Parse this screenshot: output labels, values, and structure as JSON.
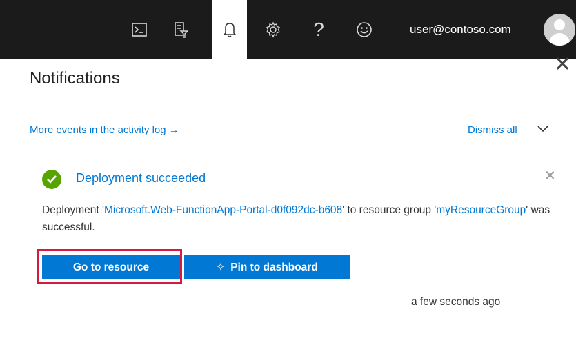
{
  "topbar": {
    "icons": [
      {
        "name": "cloud-shell-icon",
        "glyph": "⌨"
      },
      {
        "name": "directory-filter-icon",
        "glyph": "⧉"
      },
      {
        "name": "notifications-bell-icon",
        "glyph": "🔔"
      },
      {
        "name": "settings-gear-icon",
        "glyph": "⚙"
      },
      {
        "name": "help-icon",
        "glyph": "?"
      },
      {
        "name": "feedback-smiley-icon",
        "glyph": "☺"
      }
    ],
    "user_email": "user@contoso.com"
  },
  "notifications": {
    "title": "Notifications",
    "more_events_link": "More events in the activity log →",
    "dismiss_all": "Dismiss all",
    "item": {
      "title": "Deployment succeeded",
      "message_part1": "Deployment '",
      "resource_name": "Microsoft.Web-FunctionApp-Portal-d0f092dc-b608",
      "message_part2": "' to resource group '",
      "resource_group": "myResourceGroup",
      "message_part3": "' was successful.",
      "go_to_resource": "Go to resource",
      "pin_to_dashboard": "Pin to dashboard",
      "timestamp": "a few seconds ago"
    }
  },
  "colors": {
    "accent": "#0078d4",
    "success": "#57a300",
    "highlight": "#d6193f",
    "topbar": "#1b1b1b"
  }
}
